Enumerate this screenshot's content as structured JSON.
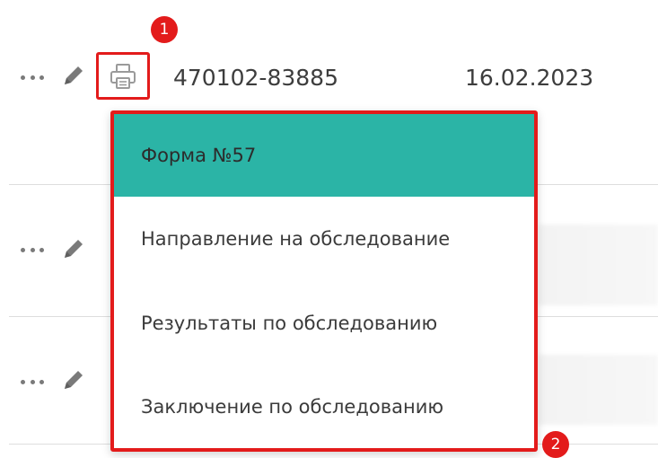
{
  "rows": [
    {
      "number": "470102-83885",
      "date": "16.02.2023"
    }
  ],
  "print_menu": {
    "items": [
      {
        "label": "Форма №57"
      },
      {
        "label": "Направление на обследование"
      },
      {
        "label": "Результаты по обследованию"
      },
      {
        "label": "Заключение по обследованию"
      }
    ]
  },
  "annotations": {
    "badge_1": "1",
    "badge_2": "2"
  },
  "colors": {
    "highlight": "#e31b1b",
    "menu_active_bg": "#2bb4a6",
    "icon_gray": "#7a7a7a"
  },
  "icons": {
    "more": "dots-icon",
    "edit": "pencil-icon",
    "print": "printer-icon"
  }
}
